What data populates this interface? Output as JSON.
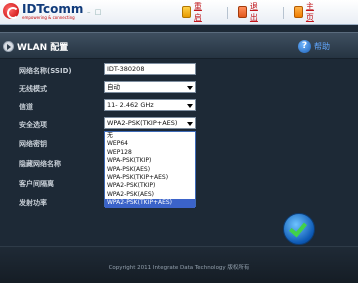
{
  "header": {
    "logo_text": "IDTcomm",
    "logo_subtext": "empowering & connecting",
    "window_controls": "– □",
    "nav": [
      {
        "label": "重启",
        "icon": "restart-icon"
      },
      {
        "label": "退出",
        "icon": "logout-icon"
      },
      {
        "label": "主页",
        "icon": "home-icon"
      }
    ]
  },
  "titlebar": {
    "title": "WLAN 配置",
    "help_label": "帮助"
  },
  "form": {
    "ssid_label": "网络名称(SSID)",
    "ssid_value": "IDT-380208",
    "wireless_mode_label": "无线模式",
    "wireless_mode_value": "自动",
    "channel_label": "信道",
    "channel_value": "11- 2.462 GHz",
    "security_label": "安全选项",
    "security_value": "WPA2-PSK(TKIP+AES)",
    "password_label": "网络密钥",
    "hidden_network_label": "隐藏网络名称",
    "client_isolation_label": "客户间隔离",
    "tx_power_label": "发射功率",
    "security_options": [
      "无",
      "WEP64",
      "WEP128",
      "WPA-PSK(TKIP)",
      "WPA-PSK(AES)",
      "WPA-PSK(TKIP+AES)",
      "WPA2-PSK(TKIP)",
      "WPA2-PSK(AES)",
      "WPA2-PSK(TKIP+AES)"
    ]
  },
  "footer": {
    "copyright": "Copyright 2011 Integrate Data Technology 版权所有"
  },
  "colors": {
    "background": "#1d2936",
    "header_bg": "#ffffff",
    "nav_text": "#c0161b",
    "help_text": "#62a8ff",
    "selection": "#3b63c9"
  }
}
